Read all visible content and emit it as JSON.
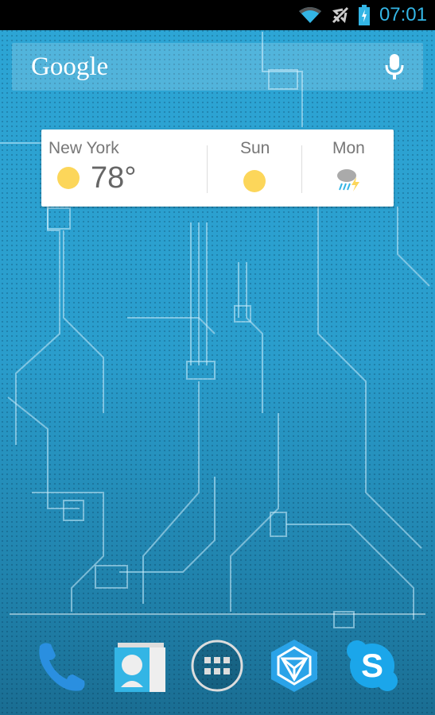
{
  "status_bar": {
    "time": "07:01",
    "icons": [
      "wifi-icon",
      "airplane-icon",
      "battery-charging-icon"
    ]
  },
  "search_widget": {
    "logo": "Google",
    "icon": "mic-icon"
  },
  "weather_widget": {
    "city": "New York",
    "temperature": "78°",
    "current_icon": "sunny-icon",
    "forecast": [
      {
        "day": "Sun",
        "icon": "sunny-icon"
      },
      {
        "day": "Mon",
        "icon": "thunderstorm-icon"
      }
    ]
  },
  "dock": {
    "items": [
      {
        "icon": "phone-icon"
      },
      {
        "icon": "contacts-icon"
      },
      {
        "icon": "app-drawer-icon"
      },
      {
        "icon": "ingress-icon"
      },
      {
        "icon": "skype-icon"
      }
    ]
  },
  "colors": {
    "accent": "#33b5e5",
    "wallpaper": "#2a9fcf"
  }
}
